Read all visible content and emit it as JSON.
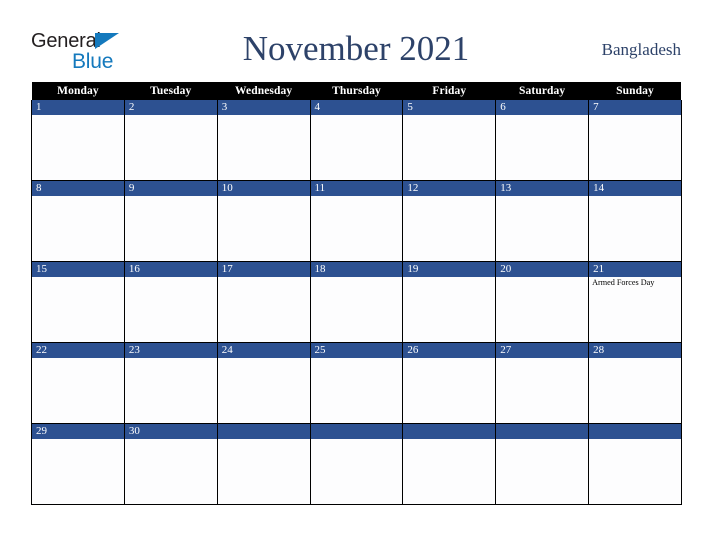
{
  "brand": {
    "name_part1": "General",
    "name_part2": "Blue",
    "triangle_color": "#1479bd"
  },
  "header": {
    "title": "November 2021",
    "country": "Bangladesh"
  },
  "theme": {
    "header_bar": "#000000",
    "day_bar": "#2d5191",
    "title_color": "#2d4269",
    "cell_bg": "#fdfdfe",
    "grid_line": "#000000"
  },
  "calendar": {
    "weekday_headers": [
      "Monday",
      "Tuesday",
      "Wednesday",
      "Thursday",
      "Friday",
      "Saturday",
      "Sunday"
    ],
    "weeks": [
      [
        {
          "date": "1",
          "events": []
        },
        {
          "date": "2",
          "events": []
        },
        {
          "date": "3",
          "events": []
        },
        {
          "date": "4",
          "events": []
        },
        {
          "date": "5",
          "events": []
        },
        {
          "date": "6",
          "events": []
        },
        {
          "date": "7",
          "events": []
        }
      ],
      [
        {
          "date": "8",
          "events": []
        },
        {
          "date": "9",
          "events": []
        },
        {
          "date": "10",
          "events": []
        },
        {
          "date": "11",
          "events": []
        },
        {
          "date": "12",
          "events": []
        },
        {
          "date": "13",
          "events": []
        },
        {
          "date": "14",
          "events": []
        }
      ],
      [
        {
          "date": "15",
          "events": []
        },
        {
          "date": "16",
          "events": []
        },
        {
          "date": "17",
          "events": []
        },
        {
          "date": "18",
          "events": []
        },
        {
          "date": "19",
          "events": []
        },
        {
          "date": "20",
          "events": []
        },
        {
          "date": "21",
          "events": [
            "Armed Forces Day"
          ]
        }
      ],
      [
        {
          "date": "22",
          "events": []
        },
        {
          "date": "23",
          "events": []
        },
        {
          "date": "24",
          "events": []
        },
        {
          "date": "25",
          "events": []
        },
        {
          "date": "26",
          "events": []
        },
        {
          "date": "27",
          "events": []
        },
        {
          "date": "28",
          "events": []
        }
      ],
      [
        {
          "date": "29",
          "events": []
        },
        {
          "date": "30",
          "events": []
        },
        {
          "date": "",
          "events": []
        },
        {
          "date": "",
          "events": []
        },
        {
          "date": "",
          "events": []
        },
        {
          "date": "",
          "events": []
        },
        {
          "date": "",
          "events": []
        }
      ]
    ]
  }
}
